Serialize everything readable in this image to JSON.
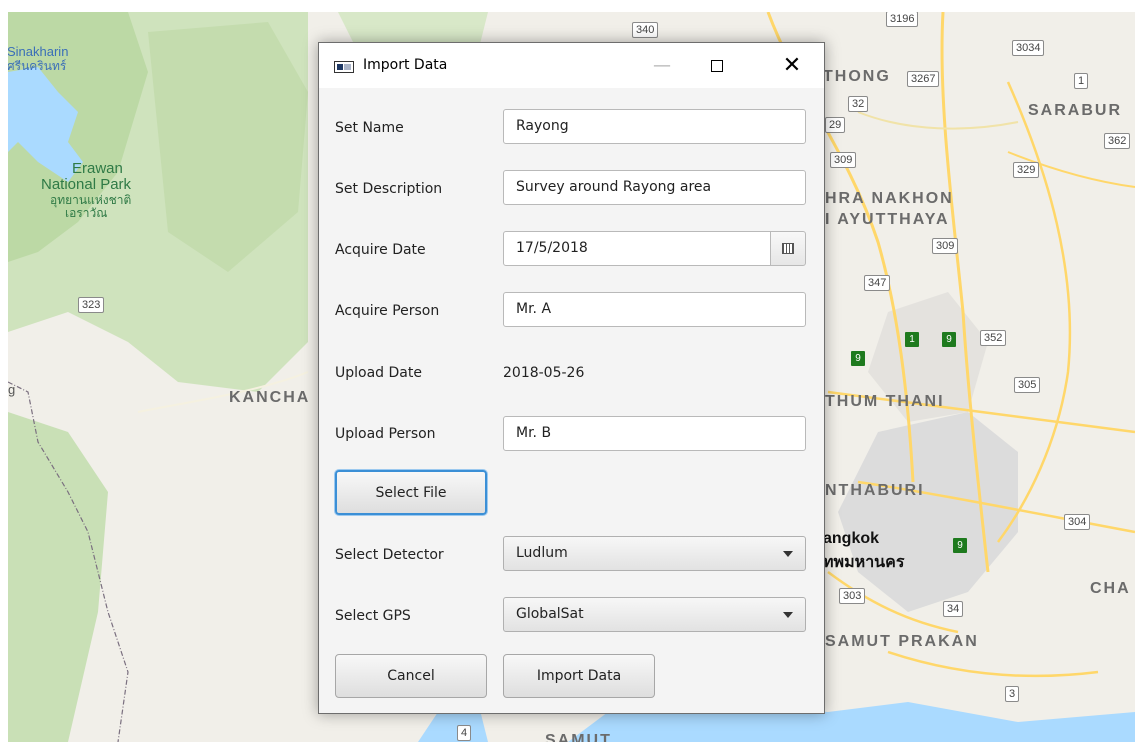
{
  "map": {
    "labels": {
      "lake_en": "Sinakharin",
      "lake_th": "ศรีนครินทร์",
      "park_en_1": "Erawan",
      "park_en_2": "National Park",
      "park_th_1": "อุทยานแห่งชาติ",
      "park_th_2": "เอราวัณ",
      "kancha": "KANCHA",
      "thong": "THONG",
      "saraburi": "SARABUR",
      "phra_nakhon_1": "HRA NAKHON",
      "phra_nakhon_2": "I AYUTTHAYA",
      "thum_thani": "THUM THANI",
      "nthaburi": "NTHABURI",
      "bangkok_en": "angkok",
      "bangkok_th": "ทพมหานคร",
      "samut_prakan": "SAMUT PRAKAN",
      "cha": "CHA",
      "samut": "SAMUT",
      "edge_g": "g"
    },
    "shields": {
      "s340": "340",
      "s3196": "3196",
      "s3034": "3034",
      "s3267": "3267",
      "s1": "1",
      "s32": "32",
      "s29": "29",
      "s362": "362",
      "s309a": "309",
      "s329": "329",
      "s309b": "309",
      "s347": "347",
      "s323": "323",
      "s352": "352",
      "s305": "305",
      "s304": "304",
      "s303": "303",
      "s34": "34",
      "s3": "3",
      "s4": "4"
    },
    "green_shields": {
      "g1": "1",
      "g9a": "9",
      "g9b": "9",
      "g9c": "9"
    }
  },
  "dialog": {
    "title": "Import Data",
    "fields": {
      "set_name": {
        "label": "Set Name",
        "value": "Rayong"
      },
      "set_description": {
        "label": "Set Description",
        "value": "Survey around Rayong area"
      },
      "acquire_date": {
        "label": "Acquire Date",
        "value": "17/5/2018"
      },
      "acquire_person": {
        "label": "Acquire Person",
        "value": "Mr. A"
      },
      "upload_date": {
        "label": "Upload Date",
        "value": "2018-05-26"
      },
      "upload_person": {
        "label": "Upload Person",
        "value": "Mr. B"
      }
    },
    "select_file_label": "Select File",
    "detector": {
      "label": "Select Detector",
      "selected": "Ludlum"
    },
    "gps": {
      "label": "Select GPS",
      "selected": "GlobalSat"
    },
    "cancel_label": "Cancel",
    "import_label": "Import Data"
  },
  "colors": {
    "focus_accent": "#3b8fd6",
    "map_water": "#aadaff",
    "map_park": "#c8e0b8",
    "map_road": "#ffd76a"
  }
}
